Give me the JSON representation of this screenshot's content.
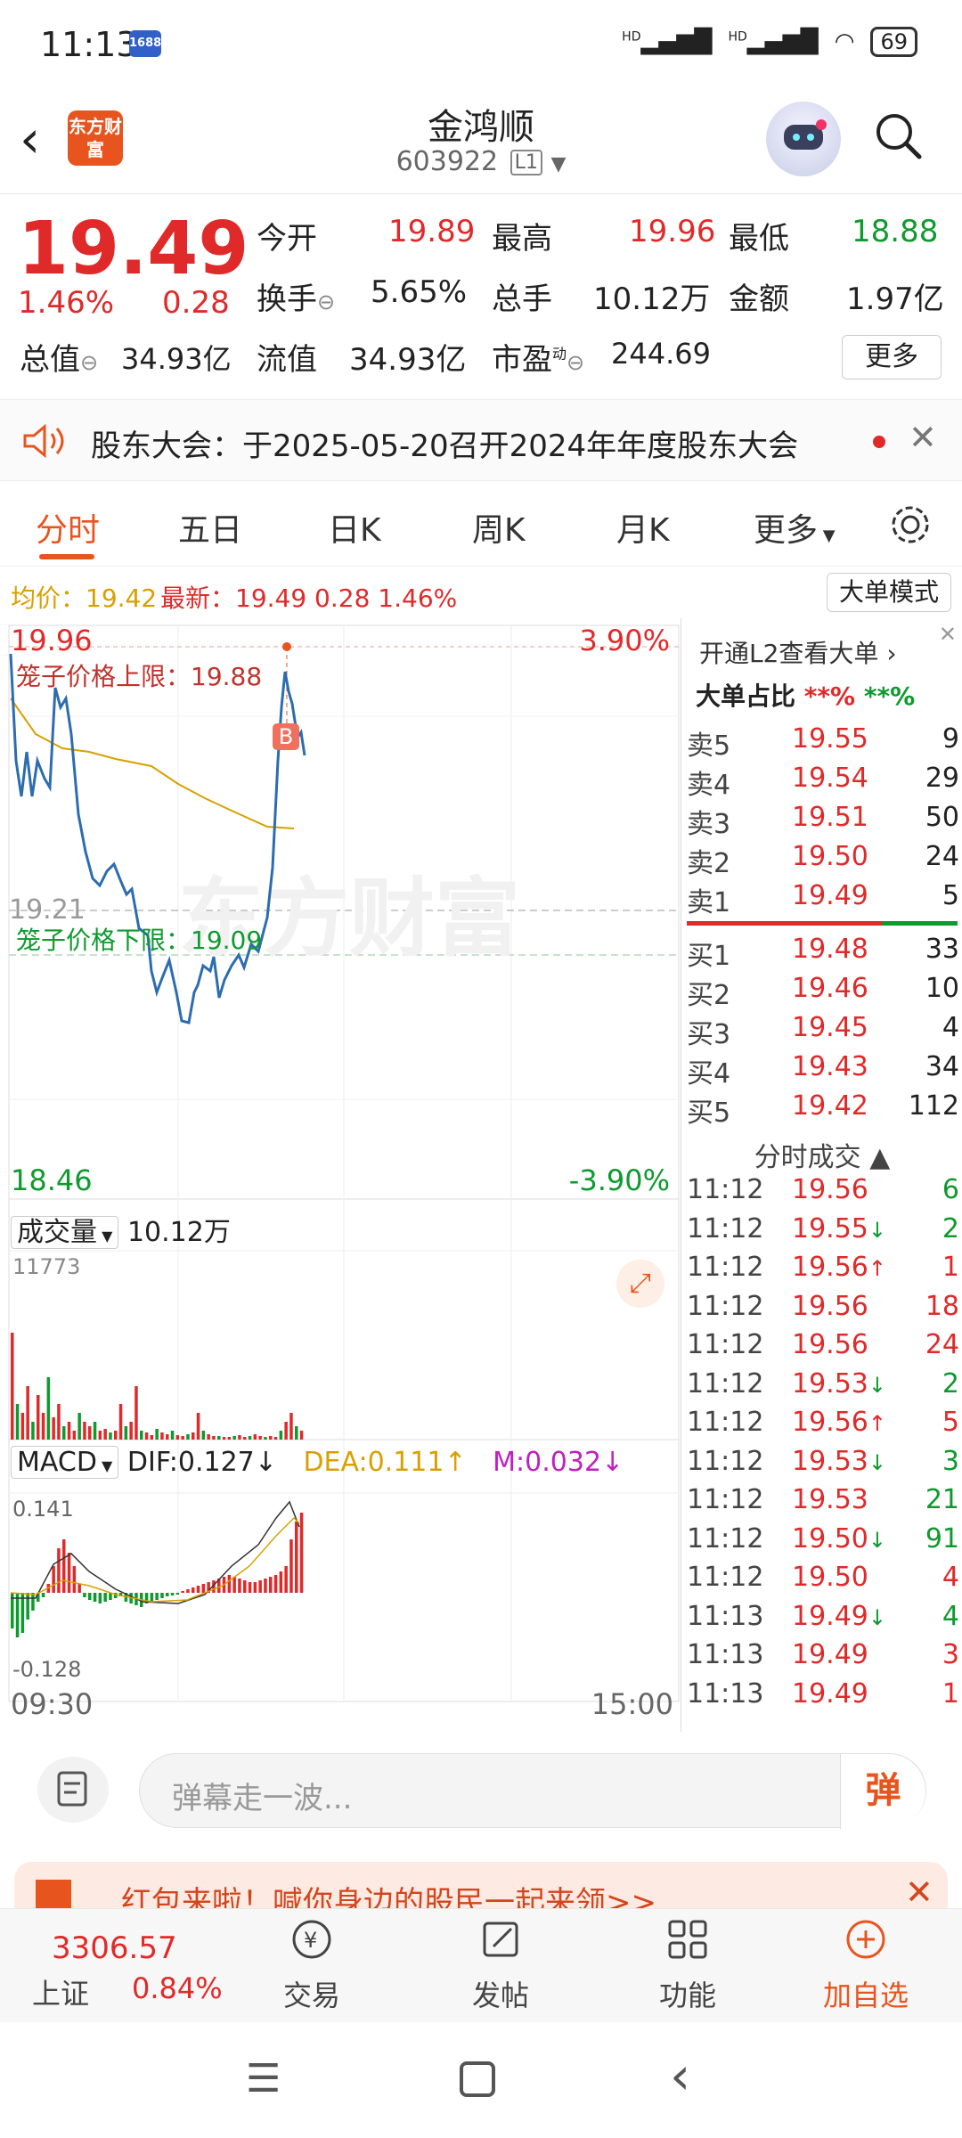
{
  "status_bar": {
    "time": "11:13",
    "app_badge": "1688",
    "network1": "HD",
    "network2": "HD",
    "battery": "69"
  },
  "header": {
    "logo": "东方财富",
    "title": "金鸿顺",
    "code": "603922",
    "level": "L1"
  },
  "quote": {
    "price": "19.49",
    "change_pct": "1.46%",
    "change": "0.28",
    "open_label": "今开",
    "open": "19.89",
    "high_label": "最高",
    "high": "19.96",
    "low_label": "最低",
    "low": "18.88",
    "turnover_label": "换手",
    "turnover": "5.65%",
    "volume_label": "总手",
    "volume": "10.12万",
    "amount_label": "金额",
    "amount": "1.97亿",
    "mktcap_label": "总值",
    "mktcap": "34.93亿",
    "float_label": "流值",
    "float": "34.93亿",
    "pe_label": "市盈",
    "pe_sup": "动",
    "pe": "244.69",
    "more": "更多"
  },
  "notice": {
    "text": "股东大会：于2025-05-20召开2024年年度股东大会"
  },
  "tabs": {
    "t1": "分时",
    "t2": "五日",
    "t3": "日K",
    "t4": "周K",
    "t5": "月K",
    "t6": "更多"
  },
  "infobar": {
    "avg": "均价：19.42",
    "latest": "最新：19.49   0.28   1.46%",
    "big_mode": "大单模式"
  },
  "chart": {
    "y_top": "19.96",
    "y_top_pct": "3.90%",
    "y_mid": "19.21",
    "y_bottom": "18.46",
    "y_bottom_pct": "-3.90%",
    "cage_upper": "笼子价格上限：19.88",
    "cage_lower": "笼子价格下限：19.09",
    "watermark": "东方财富",
    "marker": "B",
    "volume_label": "成交量",
    "volume_value": "10.12万",
    "volume_max": "11773",
    "macd_label": "MACD",
    "dif": "DIF:0.127",
    "dea": "DEA:0.111",
    "m": "M:0.032",
    "macd_top": "0.141",
    "macd_bottom": "-0.128",
    "time_start": "09:30",
    "time_end": "15:00"
  },
  "order_book": {
    "l2_link": "开通L2查看大单",
    "big_ratio_label": "大单占比",
    "ratio_red": "**%",
    "ratio_green": "**%",
    "asks": [
      {
        "label": "卖5",
        "price": "19.55",
        "vol": "9"
      },
      {
        "label": "卖4",
        "price": "19.54",
        "vol": "29"
      },
      {
        "label": "卖3",
        "price": "19.51",
        "vol": "50"
      },
      {
        "label": "卖2",
        "price": "19.50",
        "vol": "24"
      },
      {
        "label": "卖1",
        "price": "19.49",
        "vol": "5"
      }
    ],
    "bids": [
      {
        "label": "买1",
        "price": "19.48",
        "vol": "33"
      },
      {
        "label": "买2",
        "price": "19.46",
        "vol": "10"
      },
      {
        "label": "买3",
        "price": "19.45",
        "vol": "4"
      },
      {
        "label": "买4",
        "price": "19.43",
        "vol": "34"
      },
      {
        "label": "买5",
        "price": "19.42",
        "vol": "112"
      }
    ],
    "trades_title": "分时成交",
    "trades": [
      {
        "t": "11:12",
        "p": "19.56",
        "arrow": "",
        "v": "6",
        "vc": "green"
      },
      {
        "t": "11:12",
        "p": "19.55",
        "arrow": "↓",
        "v": "2",
        "vc": "green"
      },
      {
        "t": "11:12",
        "p": "19.56",
        "arrow": "↑",
        "v": "1",
        "vc": "red"
      },
      {
        "t": "11:12",
        "p": "19.56",
        "arrow": "",
        "v": "18",
        "vc": "red"
      },
      {
        "t": "11:12",
        "p": "19.56",
        "arrow": "",
        "v": "24",
        "vc": "red"
      },
      {
        "t": "11:12",
        "p": "19.53",
        "arrow": "↓",
        "v": "2",
        "vc": "green"
      },
      {
        "t": "11:12",
        "p": "19.56",
        "arrow": "↑",
        "v": "5",
        "vc": "red"
      },
      {
        "t": "11:12",
        "p": "19.53",
        "arrow": "↓",
        "v": "3",
        "vc": "green"
      },
      {
        "t": "11:12",
        "p": "19.53",
        "arrow": "",
        "v": "21",
        "vc": "green"
      },
      {
        "t": "11:12",
        "p": "19.50",
        "arrow": "↓",
        "v": "91",
        "vc": "green"
      },
      {
        "t": "11:12",
        "p": "19.50",
        "arrow": "",
        "v": "4",
        "vc": "red"
      },
      {
        "t": "11:13",
        "p": "19.49",
        "arrow": "↓",
        "v": "4",
        "vc": "green"
      },
      {
        "t": "11:13",
        "p": "19.49",
        "arrow": "",
        "v": "3",
        "vc": "red"
      },
      {
        "t": "11:13",
        "p": "19.49",
        "arrow": "",
        "v": "1",
        "vc": "red"
      }
    ]
  },
  "comment": {
    "placeholder": "弹幕走一波...",
    "dan": "弹"
  },
  "banner": {
    "text": "红包来啦！喊你身边的股民一起来领>>"
  },
  "tabbar": {
    "index_value": "3306.57",
    "index_name": "上证",
    "index_pct": "0.84%",
    "trade": "交易",
    "post": "发帖",
    "functions": "功能",
    "watch": "加自选"
  },
  "colors": {
    "up": "#e02a2a",
    "down": "#0e9a2e",
    "accent": "#e8541e",
    "avg_line": "#d8a000",
    "price_line": "#2c6cb0"
  }
}
